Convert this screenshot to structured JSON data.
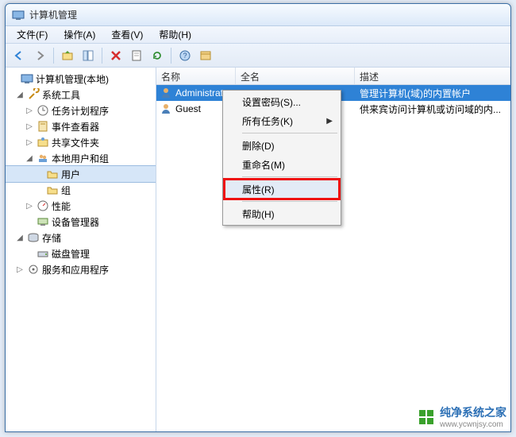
{
  "window": {
    "title": "计算机管理"
  },
  "menubar": {
    "file": "文件(F)",
    "action": "操作(A)",
    "view": "查看(V)",
    "help": "帮助(H)"
  },
  "tree": {
    "root": "计算机管理(本地)",
    "system_tools": "系统工具",
    "task_scheduler": "任务计划程序",
    "event_viewer": "事件查看器",
    "shared_folders": "共享文件夹",
    "local_users": "本地用户和组",
    "users": "用户",
    "groups": "组",
    "performance": "性能",
    "device_manager": "设备管理器",
    "storage": "存储",
    "disk_mgmt": "磁盘管理",
    "services_apps": "服务和应用程序"
  },
  "list": {
    "columns": {
      "name": "名称",
      "fullname": "全名",
      "desc": "描述"
    },
    "rows": [
      {
        "name": "Administrat",
        "fullname": "",
        "desc": "管理计算机(域)的内置帐户"
      },
      {
        "name": "Guest",
        "fullname": "",
        "desc": "供来宾访问计算机或访问域的内..."
      }
    ]
  },
  "context_menu": {
    "set_password": "设置密码(S)...",
    "all_tasks": "所有任务(K)",
    "delete": "删除(D)",
    "rename": "重命名(M)",
    "properties": "属性(R)",
    "help": "帮助(H)"
  },
  "watermark": {
    "brand": "纯净系统之家",
    "url": "www.ycwnjsy.com"
  }
}
